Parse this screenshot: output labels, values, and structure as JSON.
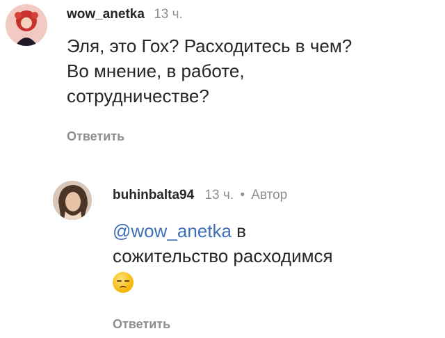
{
  "comments": [
    {
      "username": "wow_anetka",
      "time": "13 ч.",
      "text": "Эля, это Гох? Расходитесь в чем? Во мнение, в работе, сотрудничестве?",
      "text_lines": [
        "Эля, это Гох? Расходитесь в чем?",
        "Во мнение, в работе,",
        "сотрудничестве?"
      ],
      "reply_label": "Ответить"
    },
    {
      "username": "buhinbalta94",
      "time": "13 ч.",
      "separator": "•",
      "author_badge": "Автор",
      "mention": "@wow_anetka",
      "text_line1_rest": " в",
      "text_line2": "сожительство расходимся",
      "emoji": "pensive-face",
      "reply_label": "Ответить"
    }
  ],
  "colors": {
    "text": "#262626",
    "secondary": "#8e8e8e",
    "mention": "#3f6fb6"
  }
}
